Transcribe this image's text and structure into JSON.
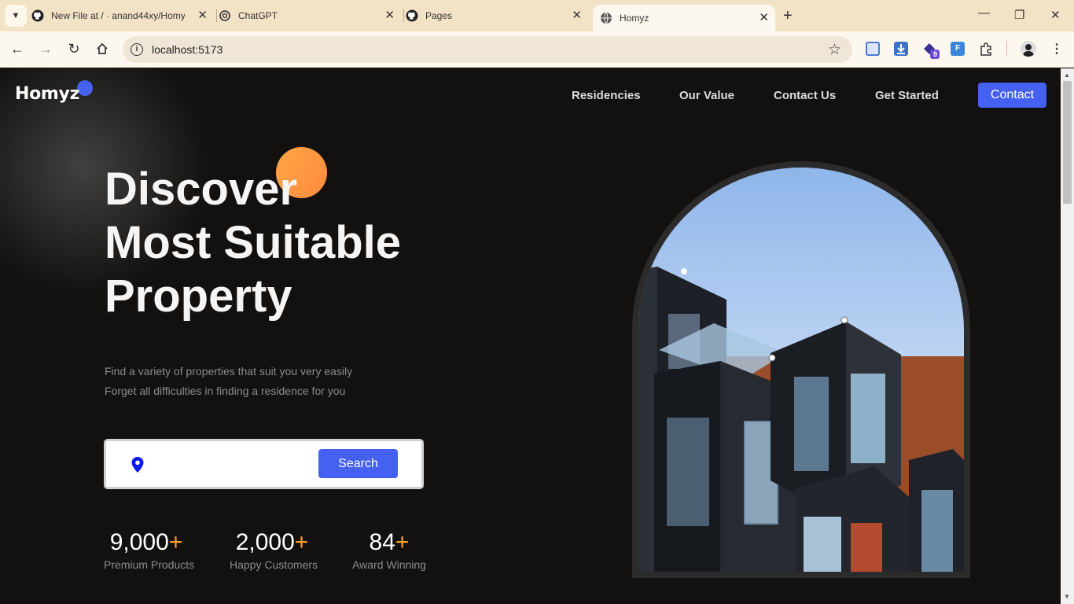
{
  "browser": {
    "tabs": [
      {
        "title": "New File at / · anand44xy/Homy",
        "icon": "github-icon"
      },
      {
        "title": "ChatGPT",
        "icon": "chatgpt-icon"
      },
      {
        "title": "Pages",
        "icon": "github-icon"
      },
      {
        "title": "Homyz",
        "icon": "globe-icon",
        "active": true
      }
    ],
    "url": "localhost:5173",
    "extension_badge": "9",
    "close_glyph": "✕",
    "new_tab_glyph": "+"
  },
  "header": {
    "logo": "Homyz",
    "nav": [
      "Residencies",
      "Our Value",
      "Contact Us",
      "Get Started"
    ],
    "contact_button": "Contact"
  },
  "hero": {
    "title_lines": [
      "Discover",
      "Most Suitable",
      "Property"
    ],
    "subtitle_lines": [
      "Find a variety of properties that suit you very easily",
      "Forget all difficulties in finding a residence for you"
    ],
    "search": {
      "placeholder": "",
      "value": "",
      "button": "Search",
      "icon": "location-pin-icon"
    },
    "stats": [
      {
        "value": "9,000",
        "suffix": "+",
        "label": "Premium Products"
      },
      {
        "value": "2,000",
        "suffix": "+",
        "label": "Happy Customers"
      },
      {
        "value": "84",
        "suffix": "+",
        "label": "Award Winning"
      }
    ]
  },
  "colors": {
    "background": "#131110",
    "accent_blue": "#4461f2",
    "accent_orange": "#ffa646",
    "plus_orange": "#ffa020",
    "subtitle_gray": "#8c8b8b"
  }
}
